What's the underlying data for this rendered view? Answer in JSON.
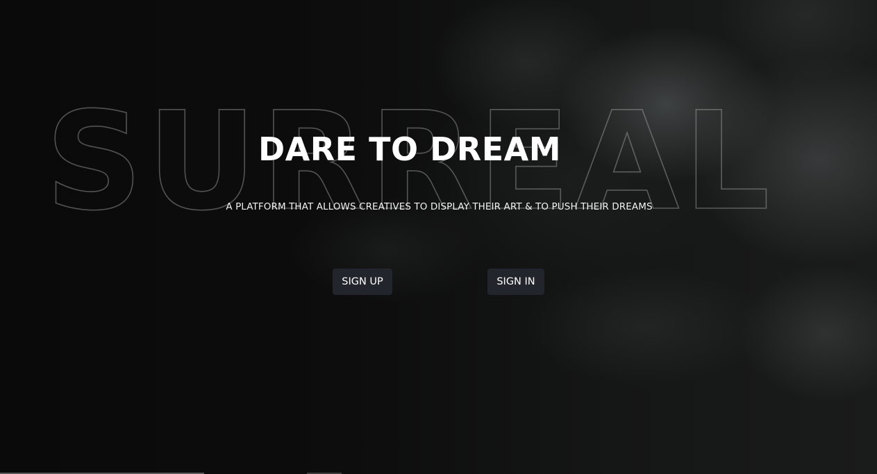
{
  "hero": {
    "watermark": "SURREAL",
    "headline": "DARE TO DREAM",
    "tagline": "A PLATFORM THAT ALLOWS CREATIVES TO DISPLAY THEIR ART & TO PUSH THEIR DREAMS"
  },
  "actions": {
    "signup_label": "SIGN UP",
    "signin_label": "SIGN IN"
  },
  "colors": {
    "background": "#0b0b0b",
    "button_bg": "#22252b",
    "text": "#ffffff"
  }
}
